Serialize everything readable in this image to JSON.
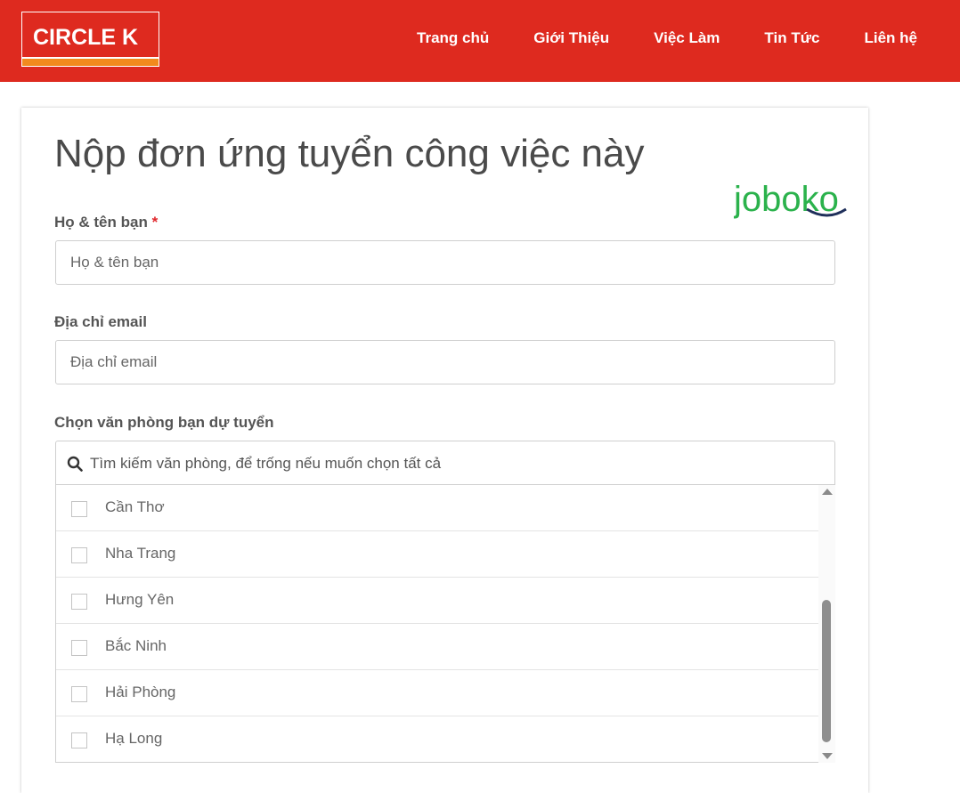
{
  "header": {
    "logo_text": "CIRCLE K",
    "nav": [
      "Trang chủ",
      "Giới Thiệu",
      "Việc Làm",
      "Tin Tức",
      "Liên hệ"
    ]
  },
  "form": {
    "title": "Nộp đơn ứng tuyển công việc này",
    "brand_logo_text": "joboko",
    "name": {
      "label": "Họ & tên bạn",
      "required_mark": "*",
      "placeholder": "Họ & tên bạn"
    },
    "email": {
      "label": "Địa chỉ email",
      "placeholder": "Địa chỉ email"
    },
    "office": {
      "label": "Chọn văn phòng bạn dự tuyển",
      "search_placeholder": "Tìm kiếm văn phòng, để trống nếu muốn chọn tất cả",
      "options": [
        "Cần Thơ",
        "Nha Trang",
        "Hưng Yên",
        "Bắc Ninh",
        "Hải Phòng",
        "Hạ Long"
      ]
    }
  },
  "colors": {
    "header_bg": "#de2a1f",
    "logo_stripe": "#f28a1e",
    "joboko_green": "#2bb24c",
    "joboko_navy": "#1f2f5a",
    "required": "#e0262b"
  }
}
